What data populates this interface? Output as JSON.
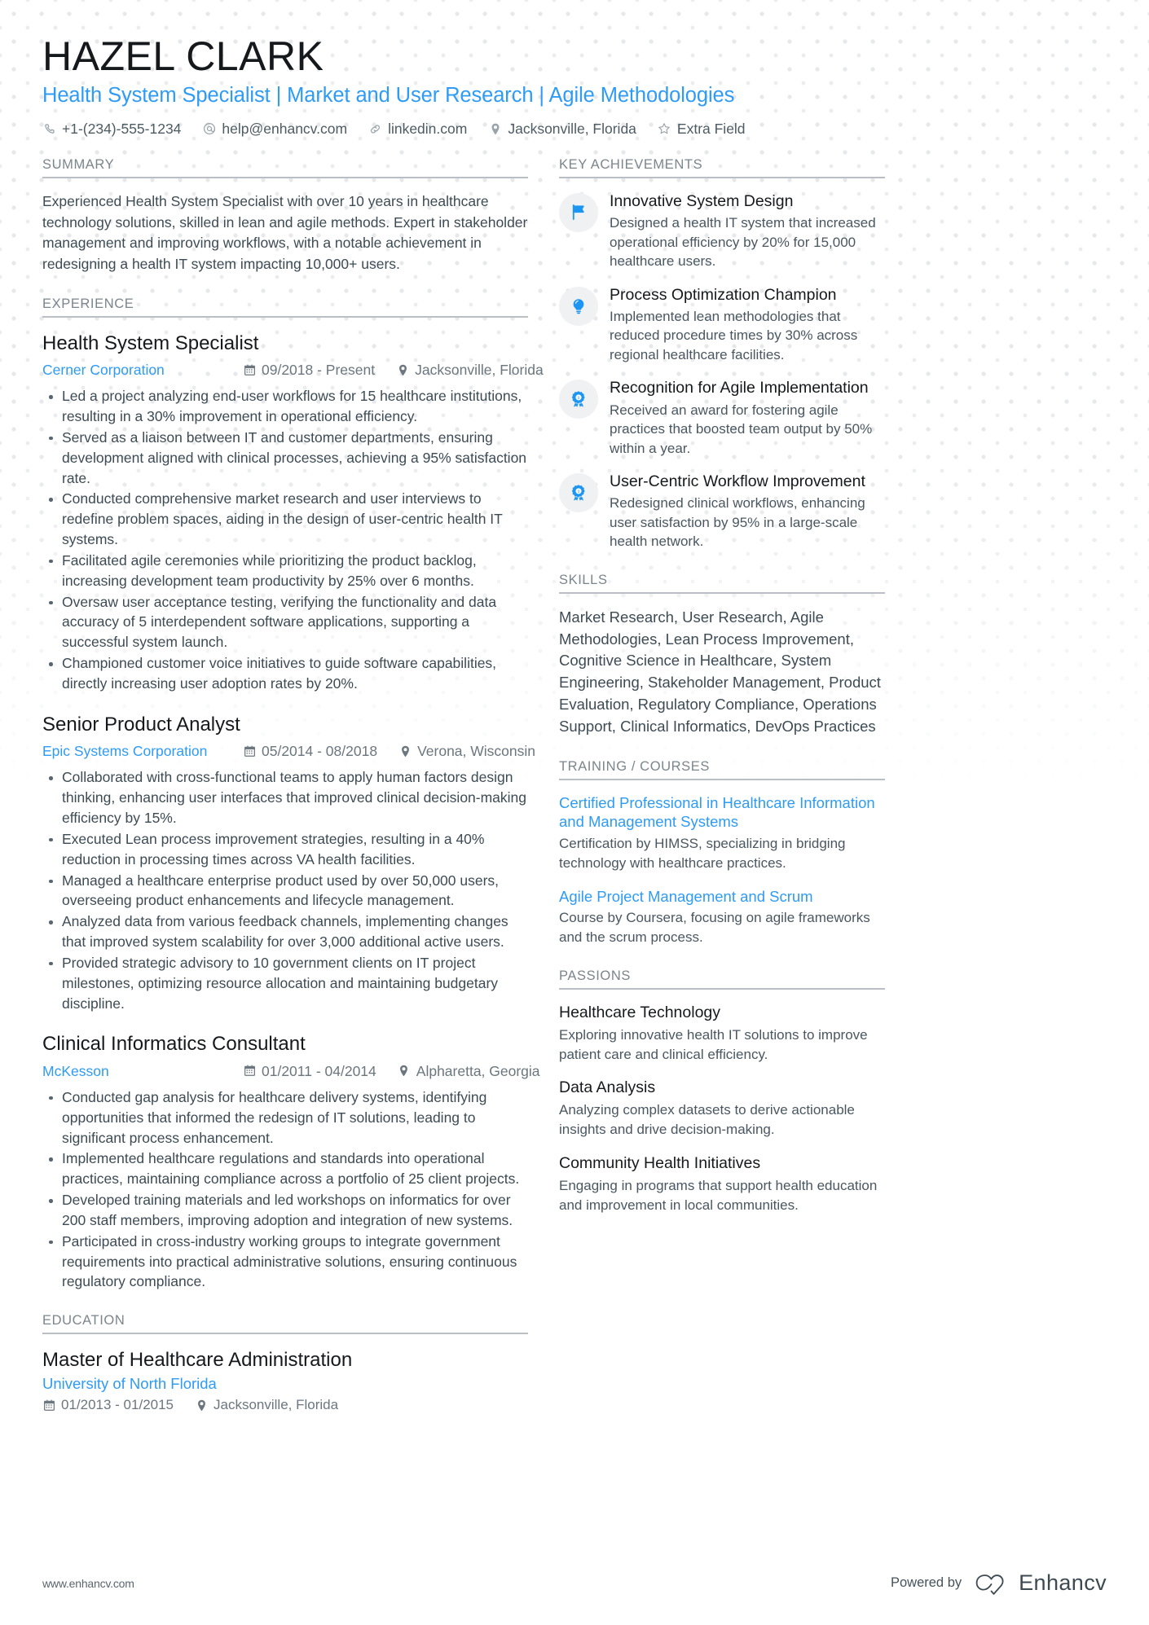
{
  "header": {
    "name": "HAZEL CLARK",
    "headline": "Health System Specialist | Market and User Research | Agile Methodologies",
    "contacts": [
      {
        "icon": "phone-icon",
        "text": "+1-(234)-555-1234"
      },
      {
        "icon": "email-icon",
        "text": "help@enhancv.com"
      },
      {
        "icon": "link-icon",
        "text": "linkedin.com"
      },
      {
        "icon": "location-pin-icon",
        "text": "Jacksonville, Florida"
      },
      {
        "icon": "star-icon",
        "text": "Extra Field"
      }
    ]
  },
  "sections": {
    "summary_title": "SUMMARY",
    "experience_title": "EXPERIENCE",
    "education_title": "EDUCATION",
    "key_achievements_title": "KEY ACHIEVEMENTS",
    "skills_title": "SKILLS",
    "training_title": "TRAINING / COURSES",
    "passions_title": "PASSIONS"
  },
  "summary": {
    "text": "Experienced Health System Specialist with over 10 years in healthcare technology solutions, skilled in lean and agile methods. Expert in stakeholder management and improving workflows, with a notable achievement in redesigning a health IT system impacting 10,000+ users."
  },
  "experience": [
    {
      "title": "Health System Specialist",
      "company": "Cerner Corporation",
      "dates": "09/2018 - Present",
      "location": "Jacksonville, Florida",
      "bullets": [
        "Led a project analyzing end-user workflows for 15 healthcare institutions, resulting in a 30% improvement in operational efficiency.",
        "Served as a liaison between IT and customer departments, ensuring development aligned with clinical processes, achieving a 95% satisfaction rate.",
        "Conducted comprehensive market research and user interviews to redefine problem spaces, aiding in the design of user-centric health IT systems.",
        "Facilitated agile ceremonies while prioritizing the product backlog, increasing development team productivity by 25% over 6 months.",
        "Oversaw user acceptance testing, verifying the functionality and data accuracy of 5 interdependent software applications, supporting a successful system launch.",
        "Championed customer voice initiatives to guide software capabilities, directly increasing user adoption rates by 20%."
      ]
    },
    {
      "title": "Senior Product Analyst",
      "company": "Epic Systems Corporation",
      "dates": "05/2014 - 08/2018",
      "location": "Verona, Wisconsin",
      "bullets": [
        "Collaborated with cross-functional teams to apply human factors design thinking, enhancing user interfaces that improved clinical decision-making efficiency by 15%.",
        "Executed Lean process improvement strategies, resulting in a 40% reduction in processing times across VA health facilities.",
        "Managed a healthcare enterprise product used by over 50,000 users, overseeing product enhancements and lifecycle management.",
        "Analyzed data from various feedback channels, implementing changes that improved system scalability for over 3,000 additional active users.",
        "Provided strategic advisory to 10 government clients on IT project milestones, optimizing resource allocation and maintaining budgetary discipline."
      ]
    },
    {
      "title": "Clinical Informatics Consultant",
      "company": "McKesson",
      "dates": "01/2011 - 04/2014",
      "location": "Alpharetta, Georgia",
      "bullets": [
        "Conducted gap analysis for healthcare delivery systems, identifying opportunities that informed the redesign of IT solutions, leading to significant process enhancement.",
        "Implemented healthcare regulations and standards into operational practices, maintaining compliance across a portfolio of 25 client projects.",
        "Developed training materials and led workshops on informatics for over 200 staff members, improving adoption and integration of new systems.",
        "Participated in cross-industry working groups to integrate government requirements into practical administrative solutions, ensuring continuous regulatory compliance."
      ]
    }
  ],
  "education": [
    {
      "degree": "Master of Healthcare Administration",
      "school": "University of North Florida",
      "dates": "01/2013 - 01/2015",
      "location": "Jacksonville, Florida"
    }
  ],
  "key_achievements": [
    {
      "icon": "flag-icon",
      "title": "Innovative System Design",
      "desc": "Designed a health IT system that increased operational efficiency by 20% for 15,000 healthcare users."
    },
    {
      "icon": "lightbulb-icon",
      "title": "Process Optimization Champion",
      "desc": "Implemented lean methodologies that reduced procedure times by 30% across regional healthcare facilities."
    },
    {
      "icon": "award-medal-icon",
      "title": "Recognition for Agile Implementation",
      "desc": "Received an award for fostering agile practices that boosted team output by 50% within a year."
    },
    {
      "icon": "award-medal-icon",
      "title": "User-Centric Workflow Improvement",
      "desc": "Redesigned clinical workflows, enhancing user satisfaction by 95% in a large-scale health network."
    }
  ],
  "skills": {
    "text": "Market Research, User Research, Agile Methodologies, Lean Process Improvement, Cognitive Science in Healthcare, System Engineering, Stakeholder Management, Product Evaluation, Regulatory Compliance, Operations Support, Clinical Informatics, DevOps Practices"
  },
  "training": [
    {
      "title": "Certified Professional in Healthcare Information and Management Systems",
      "desc": "Certification by HIMSS, specializing in bridging technology with healthcare practices."
    },
    {
      "title": "Agile Project Management and Scrum",
      "desc": "Course by Coursera, focusing on agile frameworks and the scrum process."
    }
  ],
  "passions": [
    {
      "title": "Healthcare Technology",
      "desc": "Exploring innovative health IT solutions to improve patient care and clinical efficiency."
    },
    {
      "title": "Data Analysis",
      "desc": "Analyzing complex datasets to derive actionable insights and drive decision-making."
    },
    {
      "title": "Community Health Initiatives",
      "desc": "Engaging in programs that support health education and improvement in local communities."
    }
  ],
  "footer": {
    "url": "www.enhancv.com",
    "powered_by": "Powered by",
    "brand": "Enhancv"
  },
  "colors": {
    "accent": "#2e9bf5",
    "heading": "#16191c",
    "body": "#3d4b54",
    "muted": "#7b858c"
  }
}
